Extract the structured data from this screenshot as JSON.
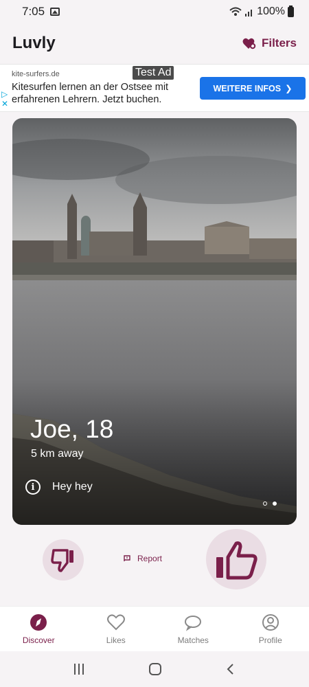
{
  "status_bar": {
    "time": "7:05",
    "battery": "100%"
  },
  "app_bar": {
    "title": "Luvly",
    "filters_label": "Filters"
  },
  "ad": {
    "domain": "kite-surfers.de",
    "badge": "Test Ad",
    "text": "Kitesurfen lernen an der Ostsee mit erfahrenen Lehrern. Jetzt buchen.",
    "button_label": "WEITERE INFOS"
  },
  "profile_card": {
    "name_age": "Joe, 18",
    "distance": "5 km away",
    "bio": "Hey hey",
    "photo_count": 2,
    "active_photo": 2
  },
  "actions": {
    "report_label": "Report"
  },
  "bottom_nav": {
    "items": [
      {
        "label": "Discover",
        "icon": "compass-icon",
        "active": true
      },
      {
        "label": "Likes",
        "icon": "heart-icon",
        "active": false
      },
      {
        "label": "Matches",
        "icon": "chat-bubble-icon",
        "active": false
      },
      {
        "label": "Profile",
        "icon": "account-circle-icon",
        "active": false
      }
    ]
  },
  "colors": {
    "accent": "#7a1f4a",
    "accent_bg": "#eadde4",
    "ad_button": "#1a73e8"
  }
}
